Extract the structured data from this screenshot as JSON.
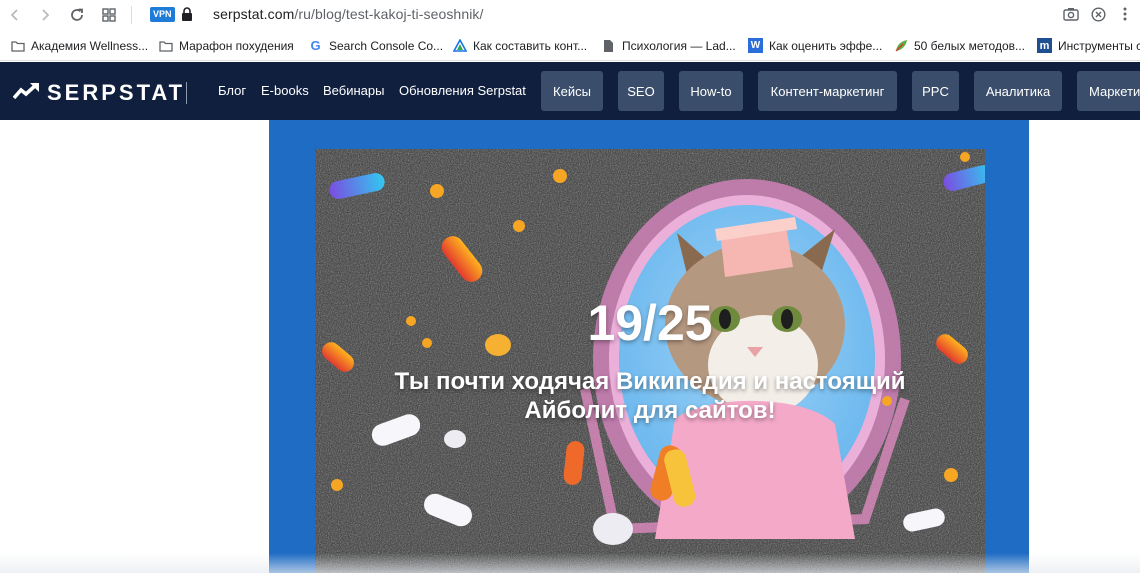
{
  "browser": {
    "url_host": "serpstat.com",
    "url_path": "/ru/blog/test-kakoj-ti-seoshnik/",
    "vpn_badge": "VPN",
    "icons": [
      "back-arrow-icon",
      "forward-arrow-icon",
      "reload-icon",
      "apps-grid-icon",
      "lock-icon",
      "camera-icon",
      "close-circle-icon",
      "more-icon"
    ]
  },
  "bookmarks": [
    {
      "label": "Академия Wellness...",
      "icon": "folder-icon"
    },
    {
      "label": "Марафон похудения",
      "icon": "folder-icon"
    },
    {
      "label": "Search Console Co...",
      "icon": "google-icon"
    },
    {
      "label": "Как составить конт...",
      "icon": "triangle-icon"
    },
    {
      "label": "Психология — Lad...",
      "icon": "document-icon"
    },
    {
      "label": "Как оценить эффе...",
      "icon": "w-icon"
    },
    {
      "label": "50 белых методов...",
      "icon": "leaf-icon"
    },
    {
      "label": "Инструменты с",
      "icon": "m-icon"
    }
  ],
  "site": {
    "logo": "SERPSTAT",
    "nav_links": [
      "Блог",
      "E-books",
      "Вебинары",
      "Обновления Serpstat"
    ],
    "categories": [
      "Кейсы",
      "SEO",
      "How-to",
      "Контент-маркетинг",
      "PPC",
      "Аналитика",
      "Маркети"
    ]
  },
  "quiz": {
    "score": "19/25",
    "result_line1": "Ты почти ходячая Википедия и настоящий",
    "result_line2": "Айболит для сайтов!"
  },
  "colors": {
    "header_bg": "#0f1f3d",
    "category_bg": "#3a4e6c",
    "content_bg": "#1f6cc4",
    "vpn_badge": "#1f7bd8"
  }
}
